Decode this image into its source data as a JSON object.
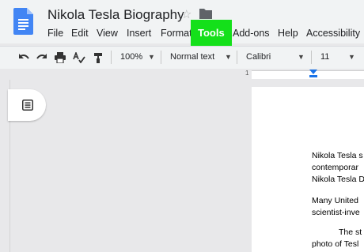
{
  "document": {
    "title": "Nikola Tesla Biography",
    "icon": "docs-icon",
    "star_icon": "star-icon",
    "folder_icon": "folder-icon"
  },
  "menu": {
    "items": [
      "File",
      "Edit",
      "View",
      "Insert",
      "Format",
      "Tools",
      "Add-ons",
      "Help",
      "Accessibility"
    ],
    "highlighted": "Tools",
    "highlight_color": "#14e01a"
  },
  "toolbar": {
    "zoom": "100%",
    "style": "Normal text",
    "font": "Calibri",
    "size": "11"
  },
  "ruler": {
    "marker_color": "#1a73e8",
    "number": "1"
  },
  "body_text": {
    "p1_l1": "Nikola Tesla s",
    "p1_l2": "contemporar",
    "p1_l3": "Nikola Tesla D",
    "p2_l1": "Many United",
    "p2_l2": "scientist-inve",
    "p3_l1": "The st",
    "p3_l2": "photo of Tesl"
  }
}
